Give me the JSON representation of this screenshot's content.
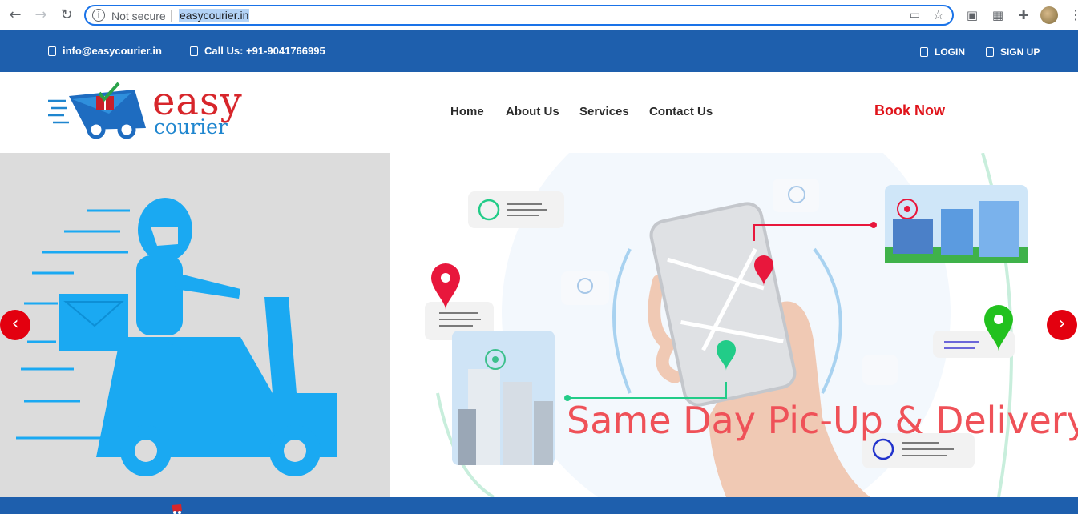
{
  "browser": {
    "security_label": "Not secure",
    "url": "easycourier.in"
  },
  "topbar": {
    "email": "info@easycourier.in",
    "phone": "Call Us: +91-9041766995",
    "login": "LOGIN",
    "signup": "SIGN UP"
  },
  "header": {
    "logo_word1": "easy",
    "logo_word2": "courier",
    "nav": [
      "Home",
      "About Us",
      "Services",
      "Contact Us"
    ],
    "cta": "Book Now"
  },
  "hero": {
    "caption": "Same Day Pic-Up & Delivery",
    "prev_label": "‹",
    "next_label": "›"
  },
  "colors": {
    "brand_blue": "#1e5fad",
    "cta_red": "#e0141b",
    "scooter_blue": "#1aa9f2",
    "caption_red": "#ef5158"
  }
}
